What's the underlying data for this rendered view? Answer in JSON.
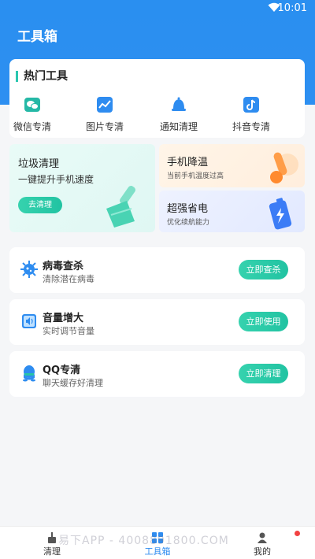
{
  "status_bar": {
    "time": "10:01"
  },
  "header": {
    "title": "工具箱"
  },
  "hot_tools": {
    "title": "热门工具",
    "items": [
      {
        "label": "微信专清",
        "icon": "wechat-icon",
        "color": "#25b8a6"
      },
      {
        "label": "图片专清",
        "icon": "image-icon",
        "color": "#2e8cf0"
      },
      {
        "label": "通知清理",
        "icon": "bell-icon",
        "color": "#2e8cf0"
      },
      {
        "label": "抖音专清",
        "icon": "tiktok-icon",
        "color": "#2e8cf0"
      }
    ]
  },
  "features": {
    "junk": {
      "title": "垃圾清理",
      "subtitle": "一键提升手机速度",
      "button": "去清理"
    },
    "cool": {
      "title": "手机降温",
      "subtitle": "当前手机温度过高"
    },
    "save": {
      "title": "超强省电",
      "subtitle": "优化续航能力"
    }
  },
  "rows": [
    {
      "title": "病毒查杀",
      "subtitle": "清除潜在病毒",
      "button": "立即查杀",
      "icon": "virus-icon"
    },
    {
      "title": "音量增大",
      "subtitle": "实时调节音量",
      "button": "立即使用",
      "icon": "volume-icon"
    },
    {
      "title": "QQ专清",
      "subtitle": "聊天缓存好清理",
      "button": "立即清理",
      "icon": "qq-icon"
    }
  ],
  "bottom_nav": [
    {
      "label": "清理",
      "icon": "broom-icon"
    },
    {
      "label": "工具箱",
      "icon": "toolbox-icon",
      "active": true
    },
    {
      "label": "我的",
      "icon": "user-icon"
    }
  ],
  "watermark": "易下APP - 4008891800.COM",
  "colors": {
    "accent": "#2e8cf0",
    "button": "#21c3a2"
  }
}
